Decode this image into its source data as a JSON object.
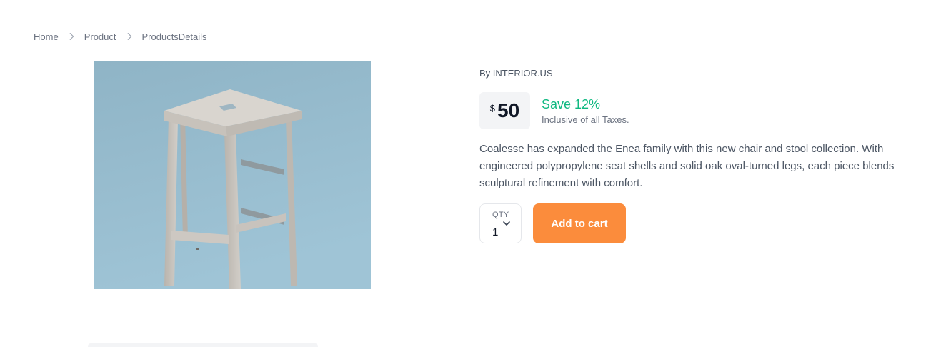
{
  "breadcrumb": {
    "items": [
      "Home",
      "Product",
      "ProductsDetails"
    ],
    "separator_icon": "chevron-right-icon"
  },
  "product": {
    "image_icon": "wooden-stool-image",
    "brand": "By INTERIOR.US",
    "currency": "$",
    "price": "50",
    "save": "Save 12%",
    "tax_note": "Inclusive of all Taxes.",
    "description": "Coalesse has expanded the Enea family with this new chair and stool collection. With engineered polypropylene seat shells and solid oak oval-turned legs, each piece blends sculptural refinement with comfort."
  },
  "quantity": {
    "label": "QTY",
    "value": "1",
    "icon": "chevron-down-icon"
  },
  "cart": {
    "button_label": "Add to cart"
  },
  "colors": {
    "accent": "#fb8c3c",
    "save_green": "#10b981",
    "image_background": "#8fb8cc"
  }
}
